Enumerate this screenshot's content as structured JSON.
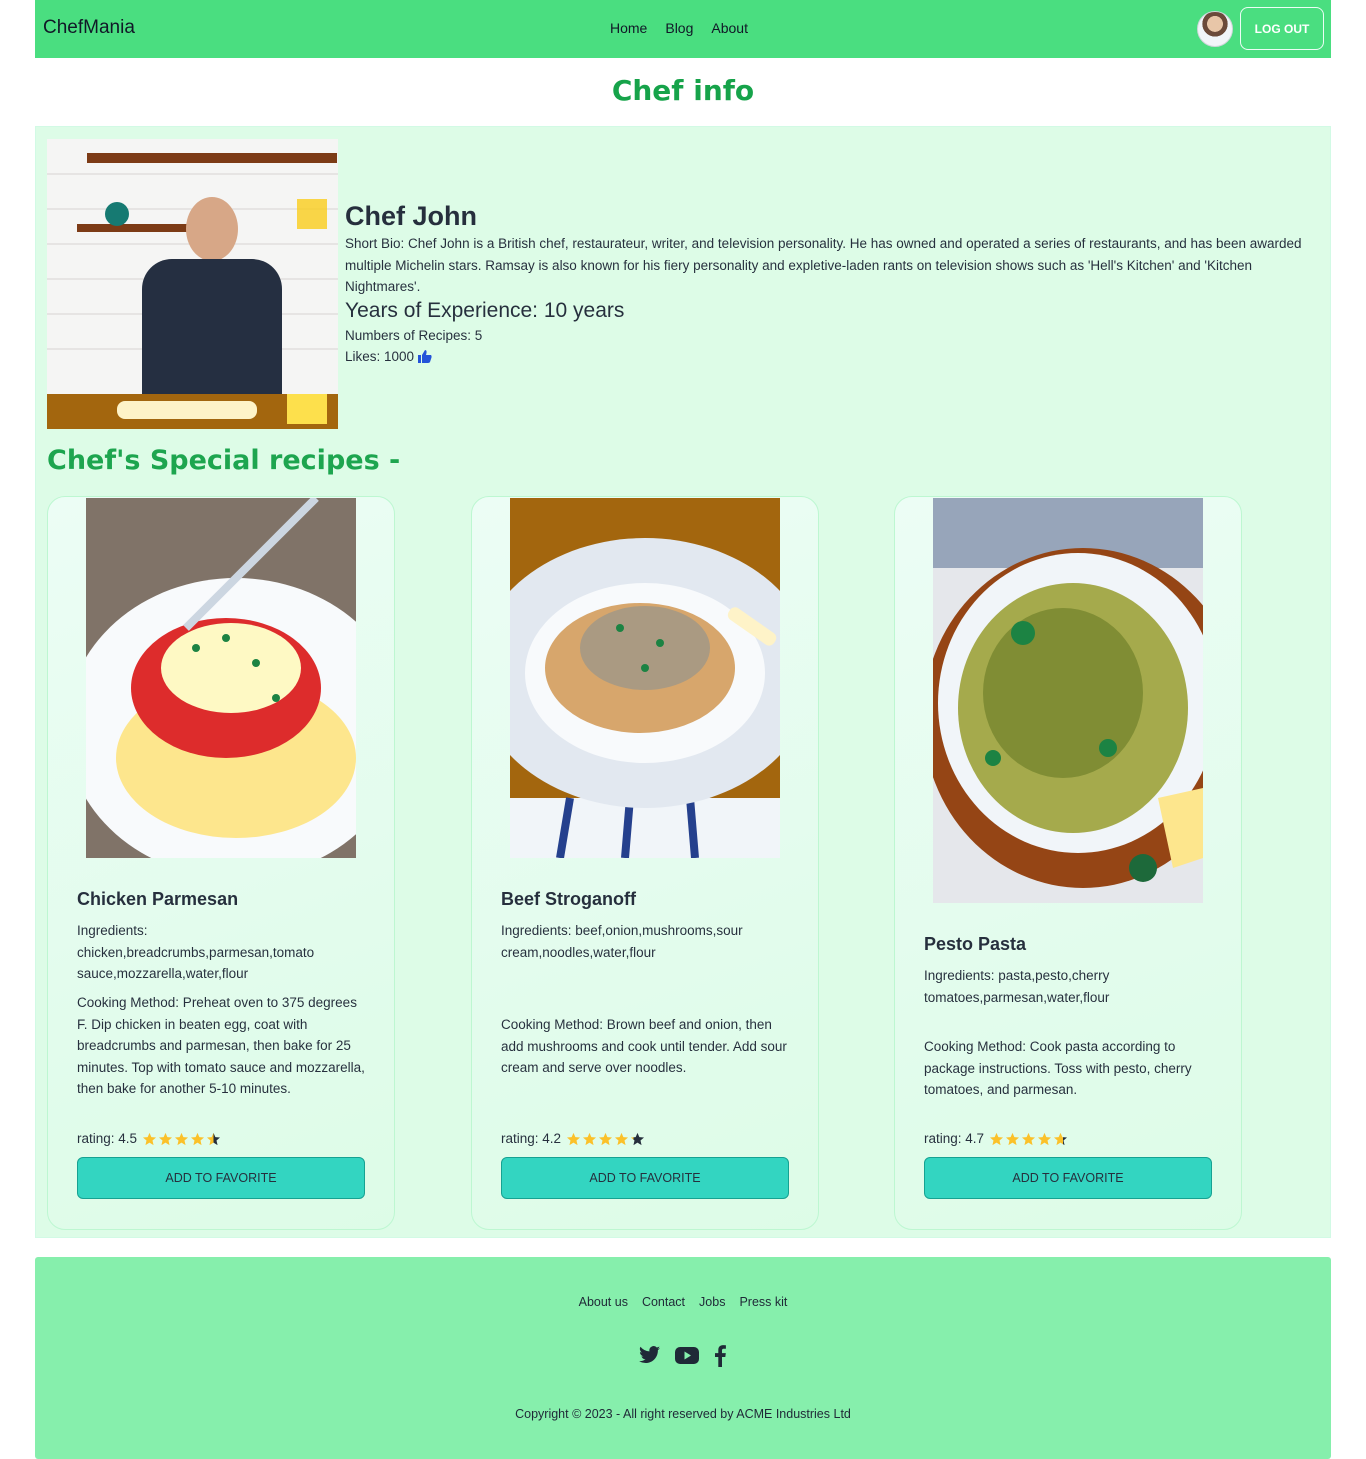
{
  "header": {
    "brand": "ChefMania",
    "nav": [
      "Home",
      "Blog",
      "About"
    ],
    "logout_label": "LOG OUT"
  },
  "page": {
    "title": "Chef info",
    "special_title": "Chef's Special recipes -"
  },
  "chef": {
    "name": "Chef John",
    "bio": "Short Bio: Chef John is a British chef, restaurateur, writer, and television personality. He has owned and operated a series of restaurants, and has been awarded multiple Michelin stars. Ramsay is also known for his fiery personality and expletive-laden rants on television shows such as 'Hell's Kitchen' and 'Kitchen Nightmares'.",
    "experience": "Years of Experience: 10 years",
    "recipes": "Numbers of Recipes: 5",
    "likes": "Likes: 1000"
  },
  "recipes": [
    {
      "title": "Chicken Parmesan",
      "ingredients": "Ingredients: chicken,breadcrumbs,parmesan,tomato sauce,mozzarella,water,flour",
      "method": "Cooking Method: Preheat oven to 375 degrees F. Dip chicken in beaten egg, coat with breadcrumbs and parmesan, then bake for 25 minutes. Top with tomato sauce and mozzarella, then bake for another 5-10 minutes.",
      "rating_label": "rating: 4.5",
      "rating": 4.5,
      "button": "ADD TO FAVORITE"
    },
    {
      "title": "Beef Stroganoff",
      "ingredients": "Ingredients: beef,onion,mushrooms,sour cream,noodles,water,flour",
      "method": "Cooking Method: Brown beef and onion, then add mushrooms and cook until tender. Add sour cream and serve over noodles.",
      "rating_label": "rating: 4.2",
      "rating": 4.2,
      "button": "ADD TO FAVORITE"
    },
    {
      "title": "Pesto Pasta",
      "ingredients": "Ingredients: pasta,pesto,cherry tomatoes,parmesan,water,flour",
      "method": "Cooking Method: Cook pasta according to package instructions. Toss with pesto, cherry tomatoes, and parmesan.",
      "rating_label": "rating: 4.7",
      "rating": 4.7,
      "button": "ADD TO FAVORITE"
    }
  ],
  "footer": {
    "links": [
      "About us",
      "Contact",
      "Jobs",
      "Press kit"
    ],
    "social_icons": [
      "twitter-icon",
      "youtube-icon",
      "facebook-icon"
    ],
    "copyright": "Copyright © 2023 - All right reserved by ACME Industries Ltd"
  },
  "colors": {
    "nav_bg": "#4ade80",
    "accent_green": "#16a34a",
    "panel_bg": "#dcfce7",
    "button_teal": "#2dd4bf",
    "footer_bg": "#86efac",
    "star_gold": "#fbbf24",
    "like_blue": "#1d4ed8"
  }
}
